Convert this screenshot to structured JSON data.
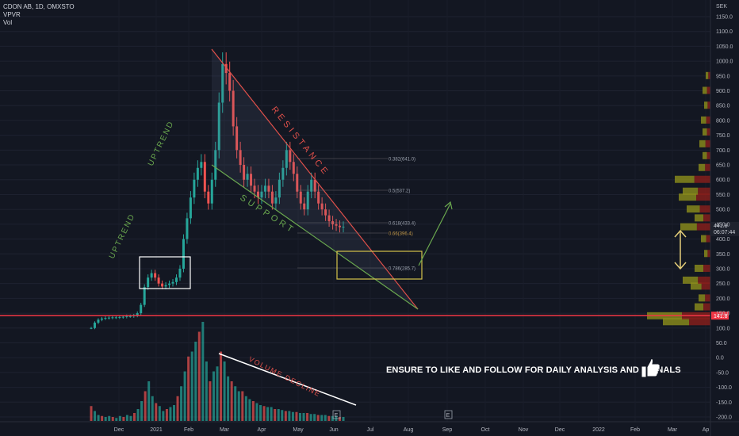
{
  "legend": {
    "symbol_line": "CDON AB, 1D, OMXSTO",
    "indicator_1": "VPVR",
    "indicator_2": "Vol"
  },
  "currency": "SEK",
  "price_axis": {
    "ticks": [
      "1150.0",
      "1100.0",
      "1050.0",
      "1000.0",
      "950.0",
      "900.0",
      "850.0",
      "800.0",
      "750.0",
      "700.0",
      "650.0",
      "600.0",
      "550.0",
      "500.0",
      "450.0",
      "400.0",
      "350.0",
      "300.0",
      "250.0",
      "200.0",
      "150.0",
      "100.0",
      "50.0",
      "0.0",
      "-50.0",
      "-100.0",
      "-150.0",
      "-200.0"
    ],
    "ticks_num": [
      1150,
      1100,
      1050,
      1000,
      950,
      900,
      850,
      800,
      750,
      700,
      650,
      600,
      550,
      500,
      450,
      400,
      350,
      300,
      250,
      200,
      150,
      100,
      50,
      0,
      -50,
      -100,
      -150,
      -200
    ],
    "current_price_label": "441.8",
    "countdown_label": "06:07:44",
    "support_line_label": "141.8"
  },
  "time_axis": {
    "labels": [
      "Dec",
      "2021",
      "Feb",
      "Mar",
      "Apr",
      "May",
      "Jun",
      "Jul",
      "Aug",
      "Sep",
      "Oct",
      "Nov",
      "Dec",
      "2022",
      "Feb",
      "Mar",
      "Ap"
    ]
  },
  "annotations": {
    "uptrend_1": "UPTREND",
    "uptrend_2": "UPTREND",
    "resistance": "RESISTANCE",
    "support": "SUPPORT",
    "volume_decline": "VOLUME DECLINE",
    "earnings_marker": "E",
    "cta": "ENSURE TO LIKE AND FOLLOW FOR DAILY ANALYSIS AND SIGNALS"
  },
  "fib_levels": [
    {
      "ratio": 0.382,
      "value": 641.0,
      "label": "0.382(641.0)"
    },
    {
      "ratio": 0.5,
      "value": 537.2,
      "label": "0.5(537.2)"
    },
    {
      "ratio": 0.618,
      "value": 433.4,
      "label": "0.618(433.4)"
    },
    {
      "ratio": 0.66,
      "value": 396.4,
      "label": "0.66(396.4)"
    },
    {
      "ratio": 0.786,
      "value": 285.7,
      "label": "0.786(285.7)"
    }
  ],
  "colors": {
    "background": "#131722",
    "up": "#26a69a",
    "down": "#ef5350",
    "resistance": "#e0504a",
    "support": "#6aa84f",
    "horizontal_line": "#f23645",
    "fib_box": "#d4c24a",
    "vpvr_up": "#8d8f1b",
    "vpvr_down": "#8b1f1c"
  },
  "chart_data": {
    "type": "candlestick",
    "symbol": "CDON AB",
    "interval": "1D",
    "exchange": "OMXSTO",
    "currency": "SEK",
    "ylim": [
      -220,
      1160
    ],
    "x_labels": [
      "Dec",
      "2021",
      "Feb",
      "Mar",
      "Apr",
      "May",
      "Jun",
      "Jul",
      "Aug",
      "Sep",
      "Oct",
      "Nov",
      "Dec",
      "2022",
      "Feb",
      "Mar",
      "Ap"
    ],
    "series": [
      {
        "name": "price_close_approx",
        "values": [
          100,
          118,
          128,
          132,
          134,
          135,
          136,
          136,
          137,
          138,
          140,
          140,
          142,
          150,
          178,
          238,
          270,
          285,
          270,
          250,
          240,
          245,
          250,
          255,
          270,
          300,
          400,
          470,
          540,
          600,
          640,
          660,
          560,
          520,
          600,
          700,
          860,
          990,
          960,
          900,
          780,
          700,
          650,
          600,
          620,
          580,
          560,
          540,
          560,
          580,
          560,
          520,
          540,
          600,
          640,
          700,
          660,
          620,
          560,
          520,
          500,
          560,
          600,
          560,
          520,
          500,
          480,
          460,
          450,
          445,
          440,
          441.8
        ]
      },
      {
        "name": "volume_relative",
        "values": [
          15,
          10,
          6,
          5,
          4,
          5,
          4,
          3,
          5,
          4,
          6,
          5,
          8,
          12,
          20,
          30,
          40,
          25,
          18,
          15,
          10,
          12,
          14,
          16,
          25,
          35,
          50,
          65,
          70,
          80,
          90,
          100,
          60,
          40,
          50,
          55,
          70,
          60,
          45,
          40,
          35,
          30,
          30,
          25,
          22,
          20,
          18,
          16,
          15,
          14,
          14,
          12,
          12,
          11,
          10,
          10,
          9,
          9,
          8,
          8,
          8,
          7,
          7,
          6,
          6,
          6,
          5,
          5,
          5,
          4,
          4
        ]
      }
    ],
    "fib_levels": [
      0.382,
      0.5,
      0.618,
      0.66,
      0.786
    ],
    "horizontal_line": 141.8,
    "last_price": 441.8
  }
}
